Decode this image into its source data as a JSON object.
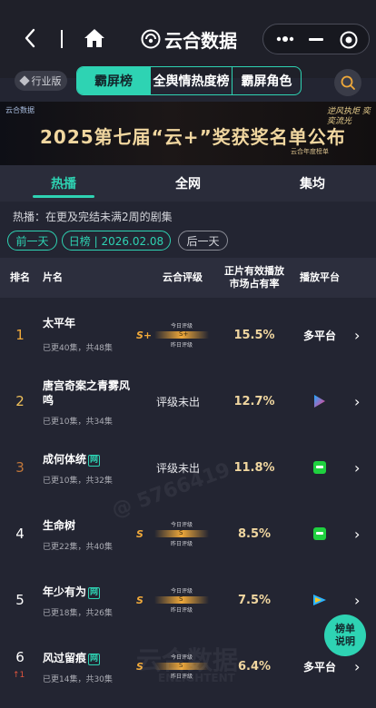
{
  "topbar": {
    "brand": "云合数据",
    "icons": {
      "back": "chevron-left-icon",
      "home": "home-icon",
      "more": "more-dots-icon",
      "minimize": "minimize-icon",
      "close": "close-circle-icon"
    }
  },
  "tabs": {
    "industry_label": "行业版",
    "items": [
      "霸屏榜",
      "全舆情热度榜",
      "霸屏角色"
    ],
    "active": 0
  },
  "banner": {
    "title": "2025第七届“云+”奖获奖名单公布",
    "logo": "云合数据",
    "slogan": "逆风执炬 奕奕流光",
    "sub": "云合年度榜单"
  },
  "subtabs": {
    "items": [
      "热播",
      "全网",
      "集均"
    ],
    "active": 0
  },
  "description": "热播：在更及完结未满2周的剧集",
  "date": {
    "prev": "前一天",
    "current": "日榜 | 2026.02.08",
    "next": "后一天"
  },
  "table": {
    "headers": {
      "rank": "排名",
      "title": "片名",
      "grade": "云合评级",
      "share": "正片有效播放市场占有率",
      "platform": "播放平台"
    },
    "grade_labels": {
      "today": "今日评级",
      "yesterday": "昨日评级"
    },
    "pending_text": "评级未出",
    "rows": [
      {
        "rank": "1",
        "title": "太平年",
        "tag": "",
        "episodes": "已更40集，共48集",
        "grade": "S+",
        "grade_inner": "S+",
        "share": "15.5%",
        "platform_text": "多平台",
        "platform_icon": "",
        "rank_change": ""
      },
      {
        "rank": "2",
        "title": "唐宫奇案之青雾风鸣",
        "tag": "",
        "episodes": "已更10集，共34集",
        "grade": "",
        "grade_inner": "",
        "share": "12.7%",
        "platform_text": "",
        "platform_icon": "youku-icon",
        "rank_change": ""
      },
      {
        "rank": "3",
        "title": "成何体统",
        "tag": "网",
        "episodes": "已更10集，共32集",
        "grade": "",
        "grade_inner": "",
        "share": "11.8%",
        "platform_text": "",
        "platform_icon": "iqiyi-icon",
        "rank_change": ""
      },
      {
        "rank": "4",
        "title": "生命树",
        "tag": "",
        "episodes": "已更22集，共40集",
        "grade": "S",
        "grade_inner": "S",
        "share": "8.5%",
        "platform_text": "",
        "platform_icon": "iqiyi-icon",
        "rank_change": ""
      },
      {
        "rank": "5",
        "title": "年少有为",
        "tag": "网",
        "episodes": "已更18集，共26集",
        "grade": "S",
        "grade_inner": "S",
        "share": "7.5%",
        "platform_text": "",
        "platform_icon": "tencent-video-icon",
        "rank_change": ""
      },
      {
        "rank": "6",
        "title": "风过留痕",
        "tag": "网",
        "episodes": "已更14集，共30集",
        "grade": "S",
        "grade_inner": "S",
        "share": "6.4%",
        "platform_text": "多平台",
        "platform_icon": "",
        "rank_change": "↑1"
      }
    ]
  },
  "fab": {
    "label": "榜单说明"
  },
  "watermarks": [
    "@ 5766419",
    "云合数据",
    "ENLIGHTENT"
  ],
  "colors": {
    "accent": "#2ed3b3",
    "rank_top": "#f0a93a",
    "rank_gold": "#f0c15a",
    "share": "#f1d7a0",
    "background": "#232532"
  }
}
